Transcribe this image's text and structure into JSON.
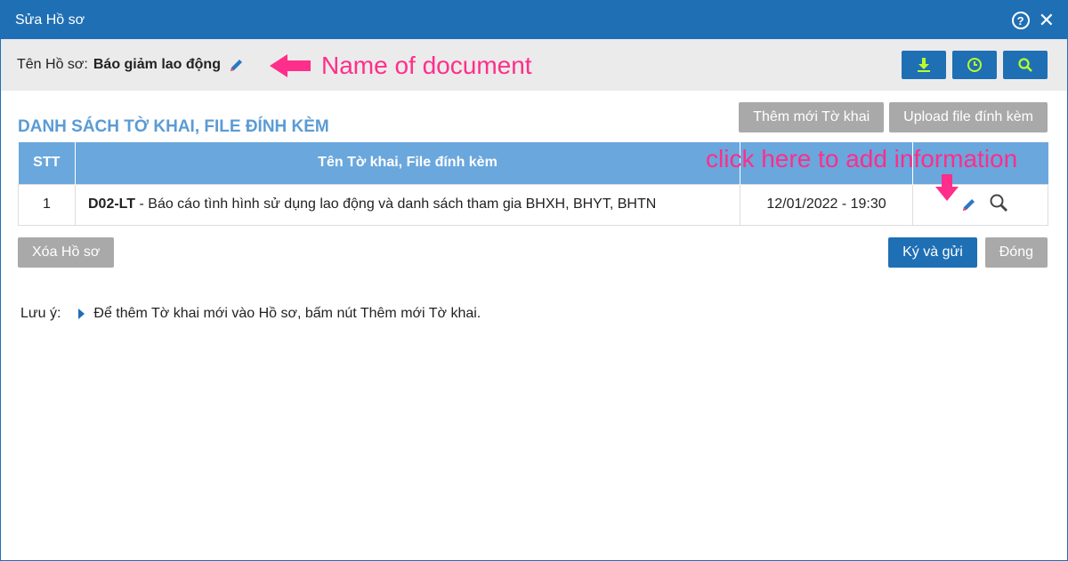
{
  "window": {
    "title": "Sửa Hồ sơ"
  },
  "namebar": {
    "label": "Tên Hồ sơ:",
    "value": "Báo giảm lao động"
  },
  "annotations": {
    "name_of_document": "Name of document",
    "click_here": "click here to add information"
  },
  "section": {
    "title": "DANH SÁCH TỜ KHAI, FILE ĐÍNH KÈM"
  },
  "buttons": {
    "add_declaration": "Thêm mới Tờ khai",
    "upload_file": "Upload file đính kèm",
    "delete_profile": "Xóa Hồ sơ",
    "sign_send": "Ký và gửi",
    "close": "Đóng"
  },
  "table": {
    "headers": {
      "stt": "STT",
      "name": "Tên Tờ khai, File đính kèm"
    },
    "rows": [
      {
        "stt": "1",
        "code": "D02-LT",
        "sep": " - ",
        "desc": "Báo cáo tình hình sử dụng lao động và danh sách tham gia BHXH, BHYT, BHTN",
        "date": "12/01/2022 - 19:30"
      }
    ]
  },
  "note": {
    "label": "Lưu ý:",
    "text": "Để thêm Tờ khai mới vào Hồ sơ, bấm nút Thêm mới Tờ khai."
  },
  "colors": {
    "primary": "#1f6fb5",
    "header": "#6aa7dd",
    "annotation": "#ff2e8a",
    "iconGreen": "#b7ff2a"
  },
  "icons": [
    "help-icon",
    "close-icon",
    "pencil-icon",
    "download-icon",
    "clock-icon",
    "search-icon",
    "arrow-left-icon",
    "arrow-down-icon",
    "triangle-right-icon"
  ]
}
